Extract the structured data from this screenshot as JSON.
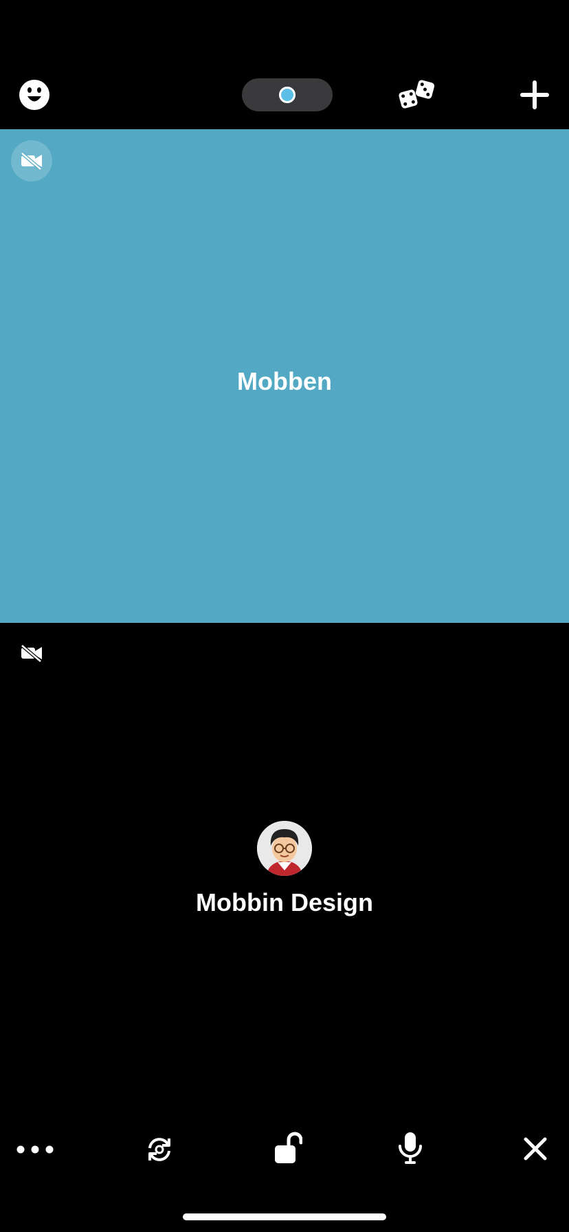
{
  "topbar": {
    "left_icon": "emoji-face-icon",
    "center_indicator": "camera-status-pill",
    "dice_icon": "dice-icon",
    "add_icon": "plus-icon"
  },
  "tiles": [
    {
      "name": "Mobben",
      "background": "#53a9c4",
      "status_icon": "video-off-icon"
    },
    {
      "name": "Mobbin Design",
      "background": "#000000",
      "status_icon": "video-off-icon",
      "avatar": "user-avatar"
    }
  ],
  "controls": [
    {
      "icon": "more-icon"
    },
    {
      "icon": "flip-camera-icon"
    },
    {
      "icon": "unlock-icon"
    },
    {
      "icon": "microphone-icon"
    },
    {
      "icon": "close-icon"
    }
  ],
  "colors": {
    "accent": "#5bbfe6",
    "tile_blue": "#53a9c4"
  }
}
